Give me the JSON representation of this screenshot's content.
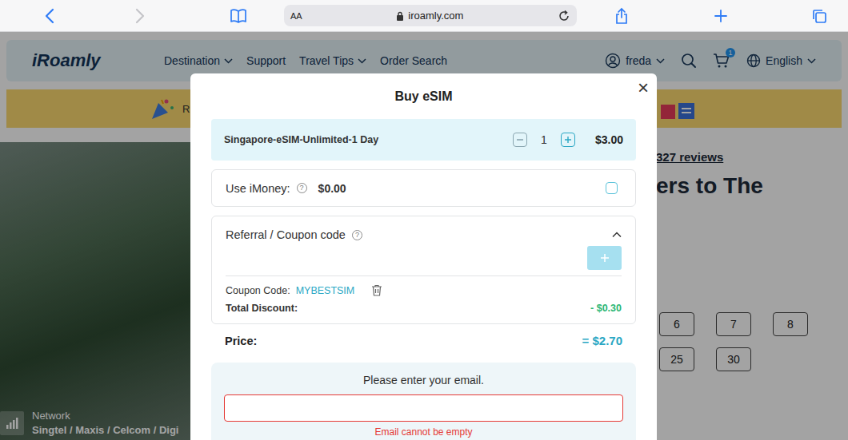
{
  "browser": {
    "text_size": "AA",
    "url": "iroamly.com"
  },
  "site": {
    "logo": "iRoamly",
    "nav": [
      {
        "label": "Destination",
        "dropdown": true
      },
      {
        "label": "Support",
        "dropdown": false
      },
      {
        "label": "Travel Tips",
        "dropdown": true
      },
      {
        "label": "Order Search",
        "dropdown": false
      }
    ],
    "user": "freda",
    "cart_badge": "1",
    "language": "English"
  },
  "banner": {
    "text": "R"
  },
  "product_page": {
    "reviews": "327 reviews",
    "heading": "ers to The",
    "days": [
      [
        "6",
        "7",
        "8"
      ],
      [
        "25",
        "30"
      ]
    ],
    "network": {
      "label": "Network",
      "carriers": "Singtel / Maxis / Celcom / Digi"
    }
  },
  "modal": {
    "title": "Buy eSIM",
    "close": "×",
    "product": {
      "name": "Singapore-eSIM-Unlimited-1 Day",
      "quantity": "1",
      "price": "$3.00"
    },
    "imoney": {
      "label": "Use iMoney:",
      "help": "?",
      "amount": "$0.00",
      "checked": false
    },
    "coupon": {
      "title": "Referral / Coupon code",
      "help": "?",
      "expanded": true,
      "input_value": "",
      "applied_label": "Coupon Code:",
      "applied_code": "MYBESTSIM",
      "discount_label": "Total Discount:",
      "discount_value": "- $0.30"
    },
    "price": {
      "label": "Price:",
      "value": "= $2.70"
    },
    "email": {
      "prompt": "Please enter your email.",
      "value": "",
      "invalid": true,
      "error": "Email cannot be empty"
    }
  }
}
